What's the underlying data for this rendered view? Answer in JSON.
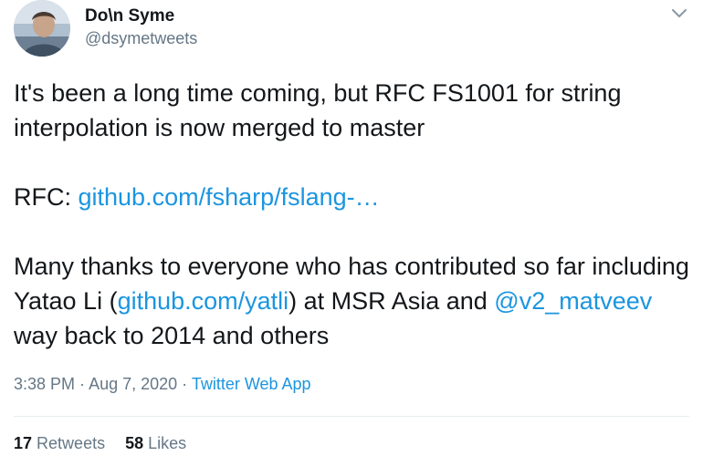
{
  "author": {
    "display_name": "Do\\n Syme",
    "handle": "@dsymetweets",
    "avatar_icon": "profile-photo"
  },
  "tweet": {
    "line1": "It's been a long time coming, but RFC FS1001 for string interpolation is now merged to master",
    "rfc_prefix": "RFC: ",
    "rfc_link": "github.com/fsharp/fslang-…",
    "thanks_text": "Many thanks to everyone who has contributed so far including Yatao Li (",
    "yatli_link": "github.com/yatli",
    "after_yatli": ") at MSR Asia and ",
    "mention": "@v2_matveev",
    "after_mention": " way back to 2014 and others"
  },
  "meta": {
    "time": "3:38 PM",
    "sep1": " · ",
    "date": "Aug 7, 2020",
    "sep2": " · ",
    "source": "Twitter Web App"
  },
  "stats": {
    "retweets_count": "17",
    "retweets_label": "Retweets",
    "likes_count": "58",
    "likes_label": "Likes"
  },
  "colors": {
    "link": "#1b95e0",
    "secondary_text": "#657786",
    "primary_text": "#14171a",
    "divider": "#e6ecf0"
  },
  "icons": {
    "menu": "chevron-down-icon"
  }
}
